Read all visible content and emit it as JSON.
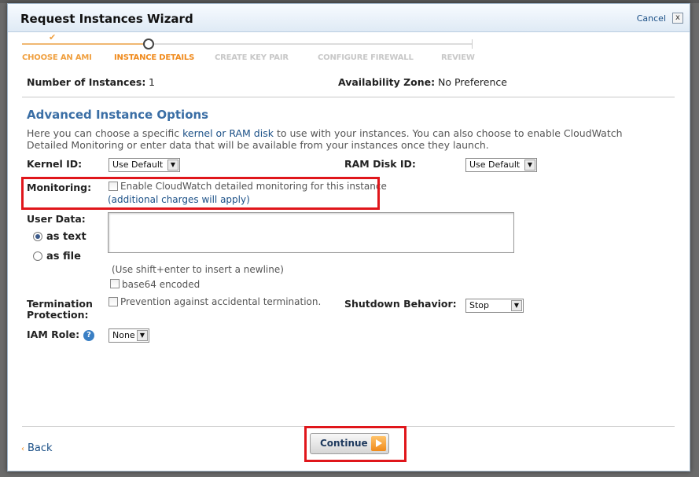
{
  "dialog": {
    "title": "Request Instances Wizard",
    "cancel_label": "Cancel",
    "close_label": "x"
  },
  "steps": [
    {
      "label": "CHOOSE AN AMI",
      "state": "done"
    },
    {
      "label": "INSTANCE DETAILS",
      "state": "current"
    },
    {
      "label": "CREATE KEY PAIR",
      "state": "future"
    },
    {
      "label": "CONFIGURE FIREWALL",
      "state": "future"
    },
    {
      "label": "REVIEW",
      "state": "future"
    }
  ],
  "summary": {
    "instances_label": "Number of Instances:",
    "instances_value": "1",
    "zone_label": "Availability Zone:",
    "zone_value": "No Preference"
  },
  "advanced": {
    "title": "Advanced Instance Options",
    "desc_pre": "Here you can choose a specific ",
    "desc_link": "kernel or RAM disk",
    "desc_post": " to use with your instances. You can also choose to enable CloudWatch Detailed Monitoring or enter data that will be available from your instances once they launch.",
    "kernel_label": "Kernel ID:",
    "kernel_value": "Use Default",
    "ramdisk_label": "RAM Disk ID:",
    "ramdisk_value": "Use Default",
    "monitoring_label": "Monitoring:",
    "monitoring_checkbox": "Enable CloudWatch detailed monitoring for this instance",
    "monitoring_note": "(additional charges will apply)",
    "userdata_label": "User Data:",
    "as_text": "as text",
    "as_file": "as file",
    "userdata_hint": "(Use shift+enter to insert a newline)",
    "base64_label": "base64 encoded",
    "termination_label_1": "Termination",
    "termination_label_2": "Protection:",
    "termination_checkbox": "Prevention against accidental termination.",
    "shutdown_label": "Shutdown Behavior:",
    "shutdown_value": "Stop",
    "iam_label": "IAM Role:",
    "iam_value": "None",
    "help_glyph": "?"
  },
  "footer": {
    "back_label": "Back",
    "back_chevron": "‹",
    "continue_label": "Continue"
  },
  "colors": {
    "highlight": "#e0161b",
    "step_active": "#f08a1c",
    "link": "#1a4f86"
  }
}
